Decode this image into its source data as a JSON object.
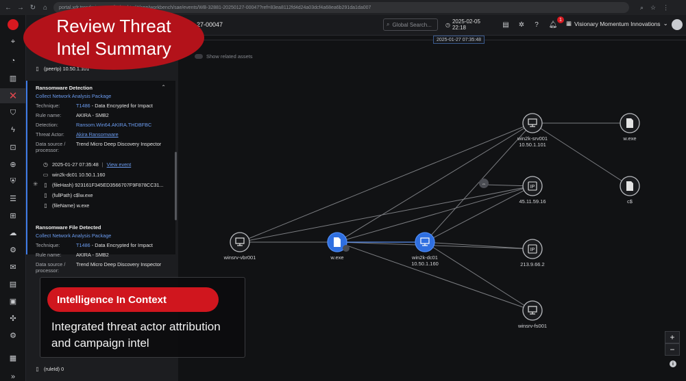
{
  "browser": {
    "url": "portal.xdr.trendmicro.com/index.html#/app/workbench/sae/events/WB-32881-20250127-00047?ref=83ea8112fd4d24a03dcf4a68ea6b291da1da007"
  },
  "header": {
    "workbench_id": "27-00047",
    "search_placeholder": "Global Search...",
    "datetime": "2025-02-05 22:18",
    "notification_count": "1",
    "org_name": "Visionary Momentum Innovations"
  },
  "timeline": {
    "timestamp": "2025-01-27 07:35:48"
  },
  "graph_toolbar": {
    "show_related_label": "Show related assets"
  },
  "panel": {
    "top_snippet": "(peerIp) 10.50.1.101",
    "card1": {
      "title": "Ransomware Detection",
      "link": "Collect Network Analysis Package",
      "rows": [
        {
          "k": "Technique:",
          "v1": "T1486",
          "v2": " - Data Encrypted for Impact"
        },
        {
          "k": "Rule name:",
          "v": "AKIRA - SMB2"
        },
        {
          "k": "Detection:",
          "v": "Ransom.Win64.AKIRA.THDBFBC"
        },
        {
          "k": "Threat Actor:",
          "v": "Akira Ransomware"
        },
        {
          "k": "Data source / processor:",
          "v": "Trend Micro Deep Discovery Inspector"
        }
      ],
      "event_time": "2025-01-27 07:35:48",
      "view_event": "View event",
      "host": "win2k-dc01  10.50.1.160",
      "file_hash": "(fileHash) 923161F345ED3566707F9F878CC31...",
      "full_path": "(fullPath) c$\\w.exe",
      "file_name": "(fileName) w.exe"
    },
    "card2": {
      "title": "Ransomware File Detected",
      "link": "Collect Network Analysis Package",
      "rows": [
        {
          "k": "Technique:",
          "v1": "T1486",
          "v2": " - Data Encrypted for Impact"
        },
        {
          "k": "Rule name:",
          "v": "AKIRA - SMB2"
        },
        {
          "k": "Data source / processor:",
          "v": "Trend Micro Deep Discovery Inspector"
        }
      ]
    },
    "bottom_snippet": "(ruleId) 0"
  },
  "graph": {
    "nodes": [
      {
        "id": "winsrv-vbr001",
        "label": "winsrv-vbr001",
        "sub": "",
        "icon": "monitor-icon",
        "hl": false
      },
      {
        "id": "w-exe-center",
        "label": "w.exe",
        "sub": "",
        "icon": "file-icon",
        "hl": true
      },
      {
        "id": "win2k-dc01",
        "label": "win2k-dc01",
        "sub": "10.50.1.160",
        "icon": "monitor-icon",
        "hl": true
      },
      {
        "id": "win2k-srv001",
        "label": "win2k-srv001",
        "sub": "10.50.1.101",
        "icon": "monitor-icon",
        "hl": false
      },
      {
        "id": "w-exe-right",
        "label": "w.exe",
        "sub": "",
        "icon": "file-icon",
        "hl": false
      },
      {
        "id": "c-share",
        "label": "c$",
        "sub": "",
        "icon": "file-icon",
        "hl": false
      },
      {
        "id": "ip-45",
        "label": "45.11.59.16",
        "sub": "",
        "icon": "ip-icon",
        "hl": false
      },
      {
        "id": "ip-213",
        "label": "213.9.66.2",
        "sub": "",
        "icon": "ip-icon",
        "hl": false
      },
      {
        "id": "winsrv-fs001",
        "label": "winsrv-fs001",
        "sub": "",
        "icon": "monitor-icon",
        "hl": false
      }
    ],
    "ip_glyph": "IP"
  },
  "overlay": {
    "title_line1": "Review Threat",
    "title_line2": "Intel Summary",
    "pill": "Intelligence In Context",
    "body": "Integrated threat actor attribution and campaign intel"
  },
  "colors": {
    "brand_red": "#d0161e",
    "accent_blue": "#3f7ce8"
  }
}
